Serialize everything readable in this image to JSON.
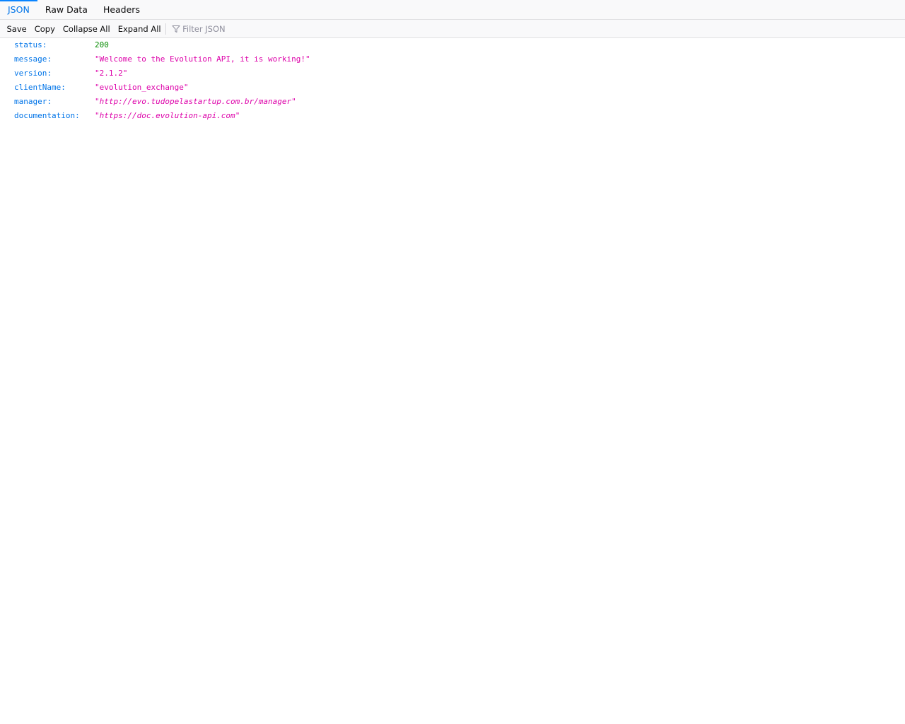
{
  "tabs": [
    {
      "label": "JSON",
      "selected": true
    },
    {
      "label": "Raw Data",
      "selected": false
    },
    {
      "label": "Headers",
      "selected": false
    }
  ],
  "toolbar": {
    "save_label": "Save",
    "copy_label": "Copy",
    "collapse_label": "Collapse All",
    "expand_label": "Expand All",
    "filter_placeholder": "Filter JSON",
    "filter_value": "",
    "filter_icon": "filter-icon"
  },
  "json": {
    "rows": [
      {
        "key": "status:",
        "value": "200",
        "type": "number"
      },
      {
        "key": "message:",
        "value": "\"Welcome to the Evolution API, it is working!\"",
        "type": "string"
      },
      {
        "key": "version:",
        "value": "\"2.1.2\"",
        "type": "string"
      },
      {
        "key": "clientName:",
        "value": "\"evolution_exchange\"",
        "type": "string"
      },
      {
        "key": "manager:",
        "value": "http://evo.tudopelastartup.com.br/manager",
        "type": "url"
      },
      {
        "key": "documentation:",
        "value": "https://doc.evolution-api.com",
        "type": "url"
      }
    ]
  },
  "colors": {
    "accent": "#0a84ff",
    "key": "#0074e8",
    "string": "#dd00a9",
    "number": "#058b00"
  }
}
